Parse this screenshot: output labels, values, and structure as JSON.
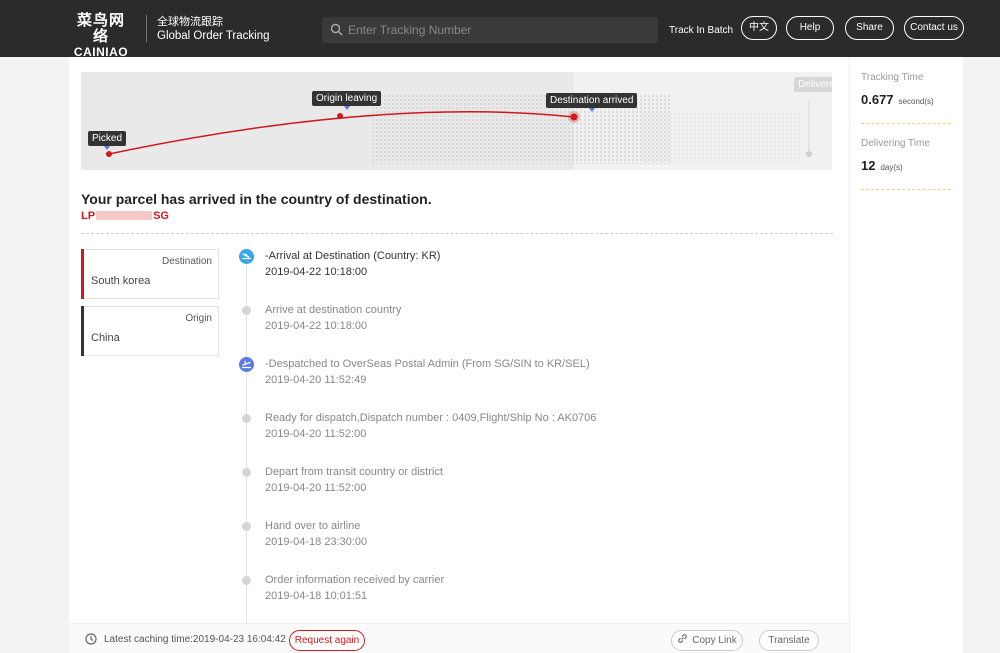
{
  "header": {
    "logo_cn": "菜鸟网络",
    "logo_en": "CAINIAO",
    "subtitle_cn": "全球物流跟踪",
    "subtitle_en": "Global Order Tracking",
    "search_placeholder": "Enter Tracking Number",
    "search_icon": "search-icon",
    "track_batch": "Track In Batch",
    "lang_button": "中文",
    "help_button": "Help",
    "share_button": "Share",
    "contact_button": "Contact us"
  },
  "progress": {
    "stages": [
      "Picked",
      "Origin leaving",
      "Destination arrived",
      "Delivere"
    ],
    "current_stage": "Destination arrived",
    "accent": "#d0181b"
  },
  "parcel": {
    "status": "Your parcel has arrived in the country of destination.",
    "tracking_prefix": "LP",
    "tracking_suffix": "SG"
  },
  "locations": {
    "destination": {
      "label": "Destination",
      "value": "South korea",
      "color": "#d0181b"
    },
    "origin": {
      "label": "Origin",
      "value": "China",
      "color": "#333333"
    }
  },
  "events": [
    {
      "title": "-Arrival at Destination (Country: KR)",
      "time": "2019-04-22 10:18:00",
      "icon": "plane-landing-icon",
      "highlight": true
    },
    {
      "title": "Arrive at destination country",
      "time": "2019-04-22 10:18:00",
      "icon": "dot",
      "highlight": false
    },
    {
      "title": "-Despatched to OverSeas Postal Admin (From SG/SIN to KR/SEL)",
      "time": "2019-04-20 11:52:49",
      "icon": "plane-takeoff-icon",
      "highlight": false
    },
    {
      "title": "Ready for dispatch,Dispatch number : 0409,Flight/Ship No : AK0706",
      "time": "2019-04-20 11:52:00",
      "icon": "dot",
      "highlight": false
    },
    {
      "title": "Depart from transit country or district",
      "time": "2019-04-20 11:52:00",
      "icon": "dot",
      "highlight": false
    },
    {
      "title": "Hand over to airline",
      "time": "2019-04-18 23:30:00",
      "icon": "dot",
      "highlight": false
    },
    {
      "title": "Order information received by carrier",
      "time": "2019-04-18 10:01:51",
      "icon": "dot",
      "highlight": false
    }
  ],
  "footer": {
    "cache_text": "Latest caching time:2019-04-23 16:04:42",
    "request_again": "Request again",
    "copy_link": "Copy Link",
    "translate": "Translate"
  },
  "stats": {
    "tracking_time_label": "Tracking Time",
    "tracking_time_value": "0.677",
    "tracking_time_unit": "second(s)",
    "delivering_time_label": "Delivering Time",
    "delivering_time_value": "12",
    "delivering_time_unit": "day(s)"
  }
}
